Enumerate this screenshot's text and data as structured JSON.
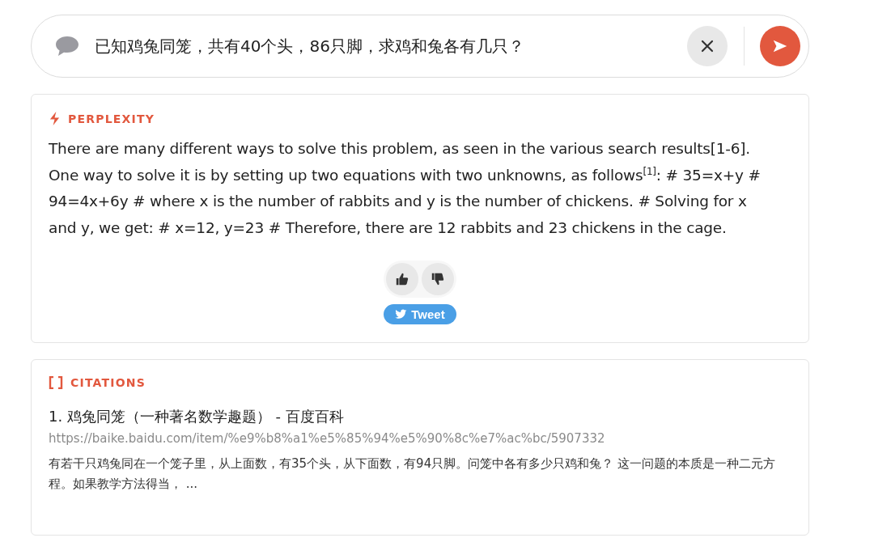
{
  "search": {
    "value": "已知鸡兔同笼，共有40个头，86只脚，求鸡和兔各有几只？"
  },
  "answer": {
    "source": "PERPLEXITY",
    "text": "There are many different ways to solve this problem, as seen in the various search results[1-6]. One way to solve it is by setting up two equations with two unknowns, as follows$^{[1]}$: # 35=x+y # 94=4x+6y # where x is the number of rabbits and y is the number of chickens. # Solving for x and y, we get: # x=12, y=23 # Therefore, there are 12 rabbits and 23 chickens in the cage.",
    "tweet": "Tweet"
  },
  "citations": {
    "heading": "CITATIONS",
    "items": [
      {
        "title": "1. 鸡兔同笼（一种著名数学趣题） - 百度百科",
        "url": "https://baike.baidu.com/item/%e9%b8%a1%e5%85%94%e5%90%8c%e7%ac%bc/5907332",
        "snippet": "有若干只鸡兔同在一个笼子里，从上面数，有35个头，从下面数，有94只脚。问笼中各有多少只鸡和兔？ 这一问题的本质是一种二元方程。如果教学方法得当， ..."
      }
    ]
  }
}
